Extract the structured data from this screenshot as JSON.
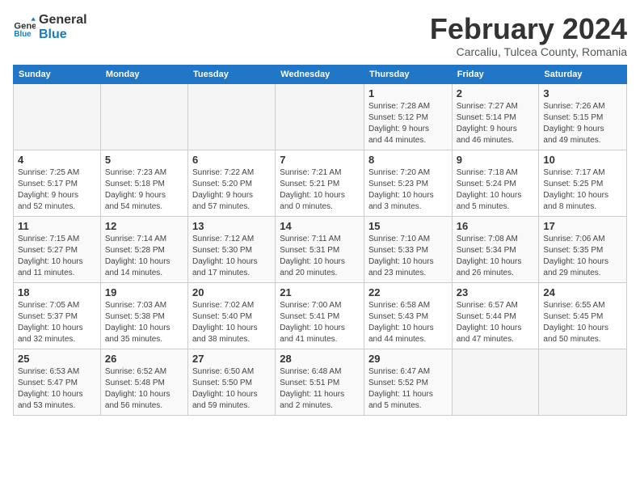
{
  "header": {
    "logo_general": "General",
    "logo_blue": "Blue",
    "month": "February 2024",
    "location": "Carcaliu, Tulcea County, Romania"
  },
  "columns": [
    "Sunday",
    "Monday",
    "Tuesday",
    "Wednesday",
    "Thursday",
    "Friday",
    "Saturday"
  ],
  "weeks": [
    [
      {
        "day": "",
        "info": ""
      },
      {
        "day": "",
        "info": ""
      },
      {
        "day": "",
        "info": ""
      },
      {
        "day": "",
        "info": ""
      },
      {
        "day": "1",
        "info": "Sunrise: 7:28 AM\nSunset: 5:12 PM\nDaylight: 9 hours\nand 44 minutes."
      },
      {
        "day": "2",
        "info": "Sunrise: 7:27 AM\nSunset: 5:14 PM\nDaylight: 9 hours\nand 46 minutes."
      },
      {
        "day": "3",
        "info": "Sunrise: 7:26 AM\nSunset: 5:15 PM\nDaylight: 9 hours\nand 49 minutes."
      }
    ],
    [
      {
        "day": "4",
        "info": "Sunrise: 7:25 AM\nSunset: 5:17 PM\nDaylight: 9 hours\nand 52 minutes."
      },
      {
        "day": "5",
        "info": "Sunrise: 7:23 AM\nSunset: 5:18 PM\nDaylight: 9 hours\nand 54 minutes."
      },
      {
        "day": "6",
        "info": "Sunrise: 7:22 AM\nSunset: 5:20 PM\nDaylight: 9 hours\nand 57 minutes."
      },
      {
        "day": "7",
        "info": "Sunrise: 7:21 AM\nSunset: 5:21 PM\nDaylight: 10 hours\nand 0 minutes."
      },
      {
        "day": "8",
        "info": "Sunrise: 7:20 AM\nSunset: 5:23 PM\nDaylight: 10 hours\nand 3 minutes."
      },
      {
        "day": "9",
        "info": "Sunrise: 7:18 AM\nSunset: 5:24 PM\nDaylight: 10 hours\nand 5 minutes."
      },
      {
        "day": "10",
        "info": "Sunrise: 7:17 AM\nSunset: 5:25 PM\nDaylight: 10 hours\nand 8 minutes."
      }
    ],
    [
      {
        "day": "11",
        "info": "Sunrise: 7:15 AM\nSunset: 5:27 PM\nDaylight: 10 hours\nand 11 minutes."
      },
      {
        "day": "12",
        "info": "Sunrise: 7:14 AM\nSunset: 5:28 PM\nDaylight: 10 hours\nand 14 minutes."
      },
      {
        "day": "13",
        "info": "Sunrise: 7:12 AM\nSunset: 5:30 PM\nDaylight: 10 hours\nand 17 minutes."
      },
      {
        "day": "14",
        "info": "Sunrise: 7:11 AM\nSunset: 5:31 PM\nDaylight: 10 hours\nand 20 minutes."
      },
      {
        "day": "15",
        "info": "Sunrise: 7:10 AM\nSunset: 5:33 PM\nDaylight: 10 hours\nand 23 minutes."
      },
      {
        "day": "16",
        "info": "Sunrise: 7:08 AM\nSunset: 5:34 PM\nDaylight: 10 hours\nand 26 minutes."
      },
      {
        "day": "17",
        "info": "Sunrise: 7:06 AM\nSunset: 5:35 PM\nDaylight: 10 hours\nand 29 minutes."
      }
    ],
    [
      {
        "day": "18",
        "info": "Sunrise: 7:05 AM\nSunset: 5:37 PM\nDaylight: 10 hours\nand 32 minutes."
      },
      {
        "day": "19",
        "info": "Sunrise: 7:03 AM\nSunset: 5:38 PM\nDaylight: 10 hours\nand 35 minutes."
      },
      {
        "day": "20",
        "info": "Sunrise: 7:02 AM\nSunset: 5:40 PM\nDaylight: 10 hours\nand 38 minutes."
      },
      {
        "day": "21",
        "info": "Sunrise: 7:00 AM\nSunset: 5:41 PM\nDaylight: 10 hours\nand 41 minutes."
      },
      {
        "day": "22",
        "info": "Sunrise: 6:58 AM\nSunset: 5:43 PM\nDaylight: 10 hours\nand 44 minutes."
      },
      {
        "day": "23",
        "info": "Sunrise: 6:57 AM\nSunset: 5:44 PM\nDaylight: 10 hours\nand 47 minutes."
      },
      {
        "day": "24",
        "info": "Sunrise: 6:55 AM\nSunset: 5:45 PM\nDaylight: 10 hours\nand 50 minutes."
      }
    ],
    [
      {
        "day": "25",
        "info": "Sunrise: 6:53 AM\nSunset: 5:47 PM\nDaylight: 10 hours\nand 53 minutes."
      },
      {
        "day": "26",
        "info": "Sunrise: 6:52 AM\nSunset: 5:48 PM\nDaylight: 10 hours\nand 56 minutes."
      },
      {
        "day": "27",
        "info": "Sunrise: 6:50 AM\nSunset: 5:50 PM\nDaylight: 10 hours\nand 59 minutes."
      },
      {
        "day": "28",
        "info": "Sunrise: 6:48 AM\nSunset: 5:51 PM\nDaylight: 11 hours\nand 2 minutes."
      },
      {
        "day": "29",
        "info": "Sunrise: 6:47 AM\nSunset: 5:52 PM\nDaylight: 11 hours\nand 5 minutes."
      },
      {
        "day": "",
        "info": ""
      },
      {
        "day": "",
        "info": ""
      }
    ]
  ]
}
